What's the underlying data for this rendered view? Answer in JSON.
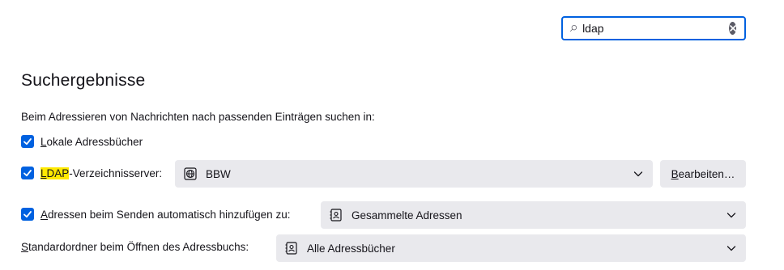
{
  "search": {
    "value": "ldap",
    "placeholder": ""
  },
  "section": {
    "title": "Suchergebnisse"
  },
  "description": "Beim Adressieren von Nachrichten nach passenden Einträgen suchen in:",
  "local_address_books": {
    "label_first": "L",
    "label_rest": "okale Adressbücher",
    "checked": true
  },
  "ldap": {
    "label_highlight_first": "L",
    "label_highlight_rest": "DAP",
    "label_rest": "-Verzeichnisserver:",
    "checked": true,
    "selected_server": "BBW",
    "edit_first": "B",
    "edit_rest": "earbeiten…"
  },
  "auto_add": {
    "label_first": "A",
    "label_rest": "dressen beim Senden automatisch hinzufügen zu:",
    "checked": true,
    "selected": "Gesammelte Adressen"
  },
  "default_folder": {
    "label_first": "S",
    "label_rest": "tandardordner beim Öffnen des Adressbuchs:",
    "selected": "Alle Adressbücher"
  },
  "colors": {
    "accent": "#0061e0",
    "highlight": "#ffe900",
    "control_bg": "#e9e9ed"
  }
}
